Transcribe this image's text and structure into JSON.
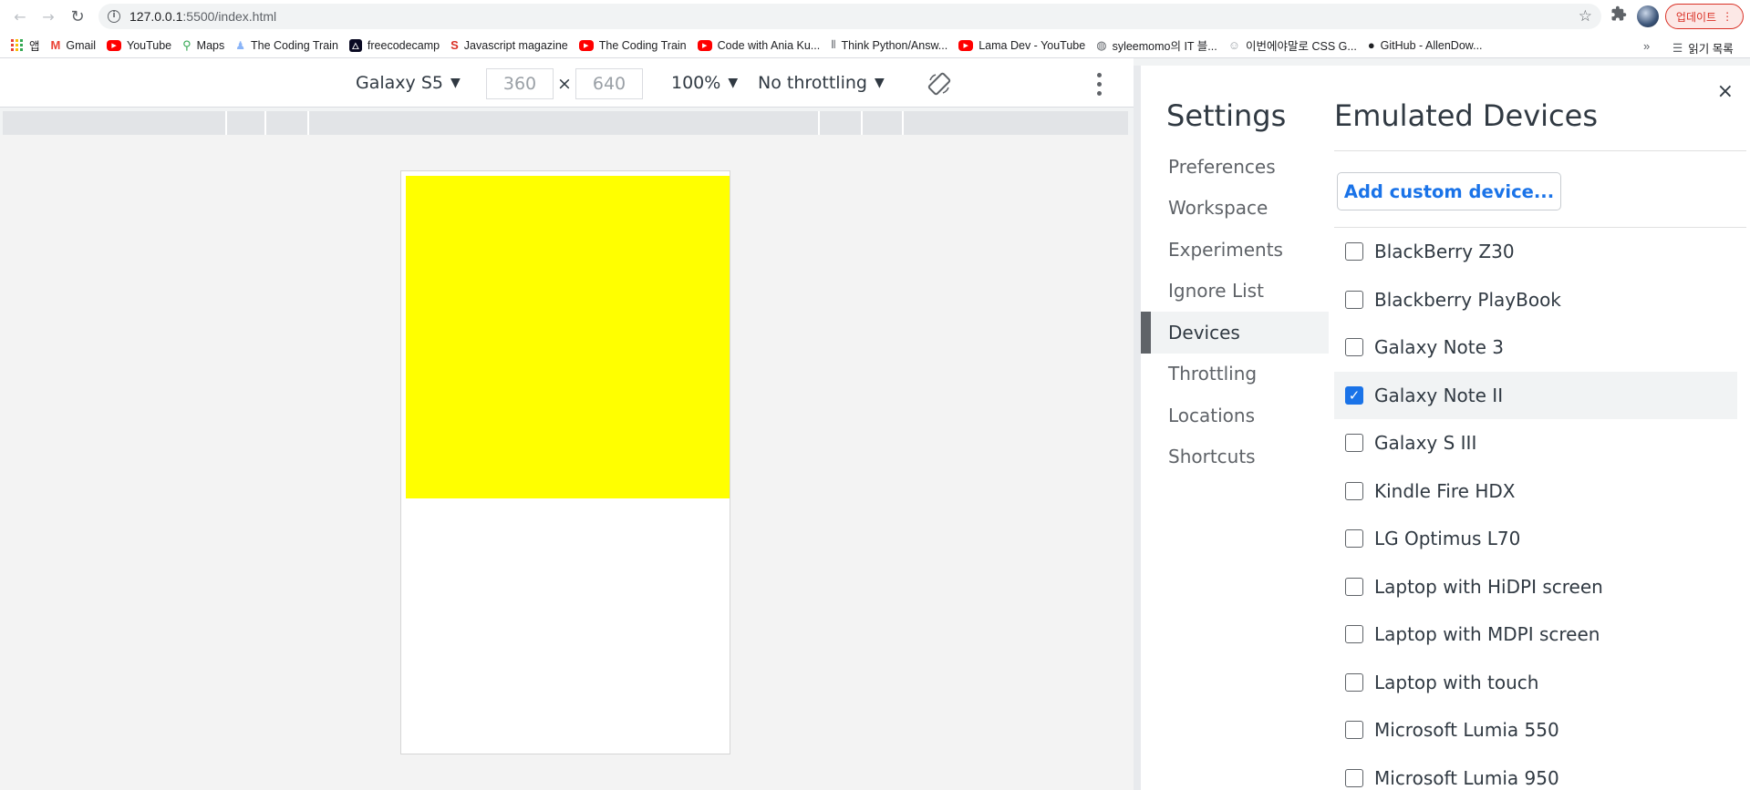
{
  "browser": {
    "url_host": "127.0.0.1",
    "url_path": ":5500/index.html",
    "update_label": "업데이트",
    "icons": {
      "back": "back-arrow-icon",
      "forward": "forward-arrow-icon",
      "reload": "reload-icon",
      "star": "star-icon"
    }
  },
  "bookmarks": [
    {
      "label": "앱",
      "icon": "apps-icon"
    },
    {
      "label": "Gmail",
      "icon": "gmail-icon"
    },
    {
      "label": "YouTube",
      "icon": "youtube-icon"
    },
    {
      "label": "Maps",
      "icon": "maps-icon"
    },
    {
      "label": "The Coding Train",
      "icon": "coding-train-icon"
    },
    {
      "label": "freecodecamp",
      "icon": "freecodecamp-icon"
    },
    {
      "label": "Javascript magazine",
      "icon": "swirl-icon"
    },
    {
      "label": "The Coding Train",
      "icon": "youtube-icon"
    },
    {
      "label": "Code with Ania Ku...",
      "icon": "youtube-icon"
    },
    {
      "label": "Think Python/Answ...",
      "icon": "book-icon"
    },
    {
      "label": "Lama Dev - YouTube",
      "icon": "youtube-icon"
    },
    {
      "label": "syleemomo의 IT 블...",
      "icon": "globe-icon"
    },
    {
      "label": "이번에야말로 CSS G...",
      "icon": "gitbook-icon"
    },
    {
      "label": "GitHub - AllenDow...",
      "icon": "github-icon"
    }
  ],
  "bookmarks_more": "»",
  "reading_list": "읽기 목록",
  "device_toolbar": {
    "device": "Galaxy S5",
    "width": "360",
    "height": "640",
    "times": "×",
    "zoom": "100%",
    "throttling": "No throttling"
  },
  "settings": {
    "title": "Settings",
    "close": "×",
    "nav": [
      "Preferences",
      "Workspace",
      "Experiments",
      "Ignore List",
      "Devices",
      "Throttling",
      "Locations",
      "Shortcuts"
    ],
    "active_nav": "Devices",
    "section_title": "Emulated Devices",
    "add_button": "Add custom device...",
    "devices": [
      {
        "name": "BlackBerry Z30",
        "checked": false
      },
      {
        "name": "Blackberry PlayBook",
        "checked": false
      },
      {
        "name": "Galaxy Note 3",
        "checked": false
      },
      {
        "name": "Galaxy Note II",
        "checked": true
      },
      {
        "name": "Galaxy S III",
        "checked": false
      },
      {
        "name": "Kindle Fire HDX",
        "checked": false
      },
      {
        "name": "LG Optimus L70",
        "checked": false
      },
      {
        "name": "Laptop with HiDPI screen",
        "checked": false
      },
      {
        "name": "Laptop with MDPI screen",
        "checked": false
      },
      {
        "name": "Laptop with touch",
        "checked": false
      },
      {
        "name": "Microsoft Lumia 550",
        "checked": false
      },
      {
        "name": "Microsoft Lumia 950",
        "checked": false
      }
    ]
  },
  "colors": {
    "preview_box": "#ffff00",
    "accent": "#1a73e8",
    "update": "#d93025"
  }
}
